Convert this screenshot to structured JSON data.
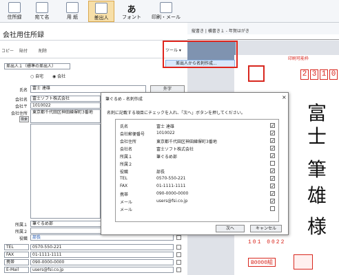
{
  "ribbon": {
    "items": [
      "住所録",
      "宛て名",
      "用 紙",
      "差出人",
      "フォント",
      "印刷・メール"
    ],
    "active_index": 3
  },
  "left": {
    "title": "会社用住所録",
    "toolbar": [
      "コピー",
      "貼付",
      "削除"
    ],
    "sender_select": "差出人１（標準の差出人）",
    "radio_home": "自宅",
    "radio_company": "会社",
    "name_label": "氏名",
    "name_value": "富士 達雄",
    "gaiji_button": "外字",
    "company_name_label": "会社名",
    "company_name_value": "富士ソフト株式会社",
    "company_zip_label": "会社〒",
    "company_zip_value": "1010022",
    "company_addr_label": "会社住所",
    "company_addr_value": "東京都千代田区神田練塀町3番地",
    "search_button": "検索",
    "dept1_label": "所属１",
    "dept1_value": "筆ぐるめ部",
    "dept2_label": "所属２",
    "dept2_value": "",
    "position_label": "役職",
    "position_value": "部長",
    "contacts": [
      {
        "label": "TEL",
        "value": "0570-550-221"
      },
      {
        "label": "FAX",
        "value": "01-1111-1111"
      },
      {
        "label": "携帯",
        "value": "090-0000-0000"
      },
      {
        "label": "E-Mail",
        "value": "users@fsi.co.jp"
      }
    ]
  },
  "right": {
    "tabs": "縦書き | 横書き１ - 年賀はがき",
    "tool_button": "ツール",
    "tool_menu_item": "差出人から名刺作成...",
    "postal_label": "印刷可能枠",
    "postal_code_top": [
      "2",
      "3",
      "1",
      "0"
    ],
    "name_vertical": [
      "富",
      "士",
      "筆",
      "雄",
      "様"
    ],
    "postal_code_bottom": "101 0022",
    "lottery": "B0000組"
  },
  "dialog": {
    "title": "筆ぐるめ - 名刺作成",
    "instruction": "名刺に記載する項目にチェックを入れ、「次へ」ボタンを押してください。",
    "rows": [
      {
        "key": "氏名",
        "value": "富士 達雄",
        "checked": true
      },
      {
        "key": "会社郵便番号",
        "value": "1010022",
        "checked": true
      },
      {
        "key": "会社住所",
        "value": "東京都千代田区神田練塀町3番地",
        "checked": true
      },
      {
        "key": "会社名",
        "value": "富士ソフト株式会社",
        "checked": true
      },
      {
        "key": "所属１",
        "value": "筆ぐるめ部",
        "checked": true
      },
      {
        "key": "所属２",
        "value": "",
        "checked": false
      },
      {
        "key": "役職",
        "value": "部長",
        "checked": true
      },
      {
        "key": "TEL",
        "value": "0570-550-221",
        "checked": true
      },
      {
        "key": "FAX",
        "value": "01-1111-1111",
        "checked": true
      },
      {
        "key": "携帯",
        "value": "090-0000-0000",
        "checked": true
      },
      {
        "key": "メール",
        "value": "users@fsi.co.jp",
        "checked": true
      },
      {
        "key": "メール",
        "value": "",
        "checked": false
      }
    ],
    "next_button": "次へ",
    "cancel_button": "キャンセル"
  }
}
